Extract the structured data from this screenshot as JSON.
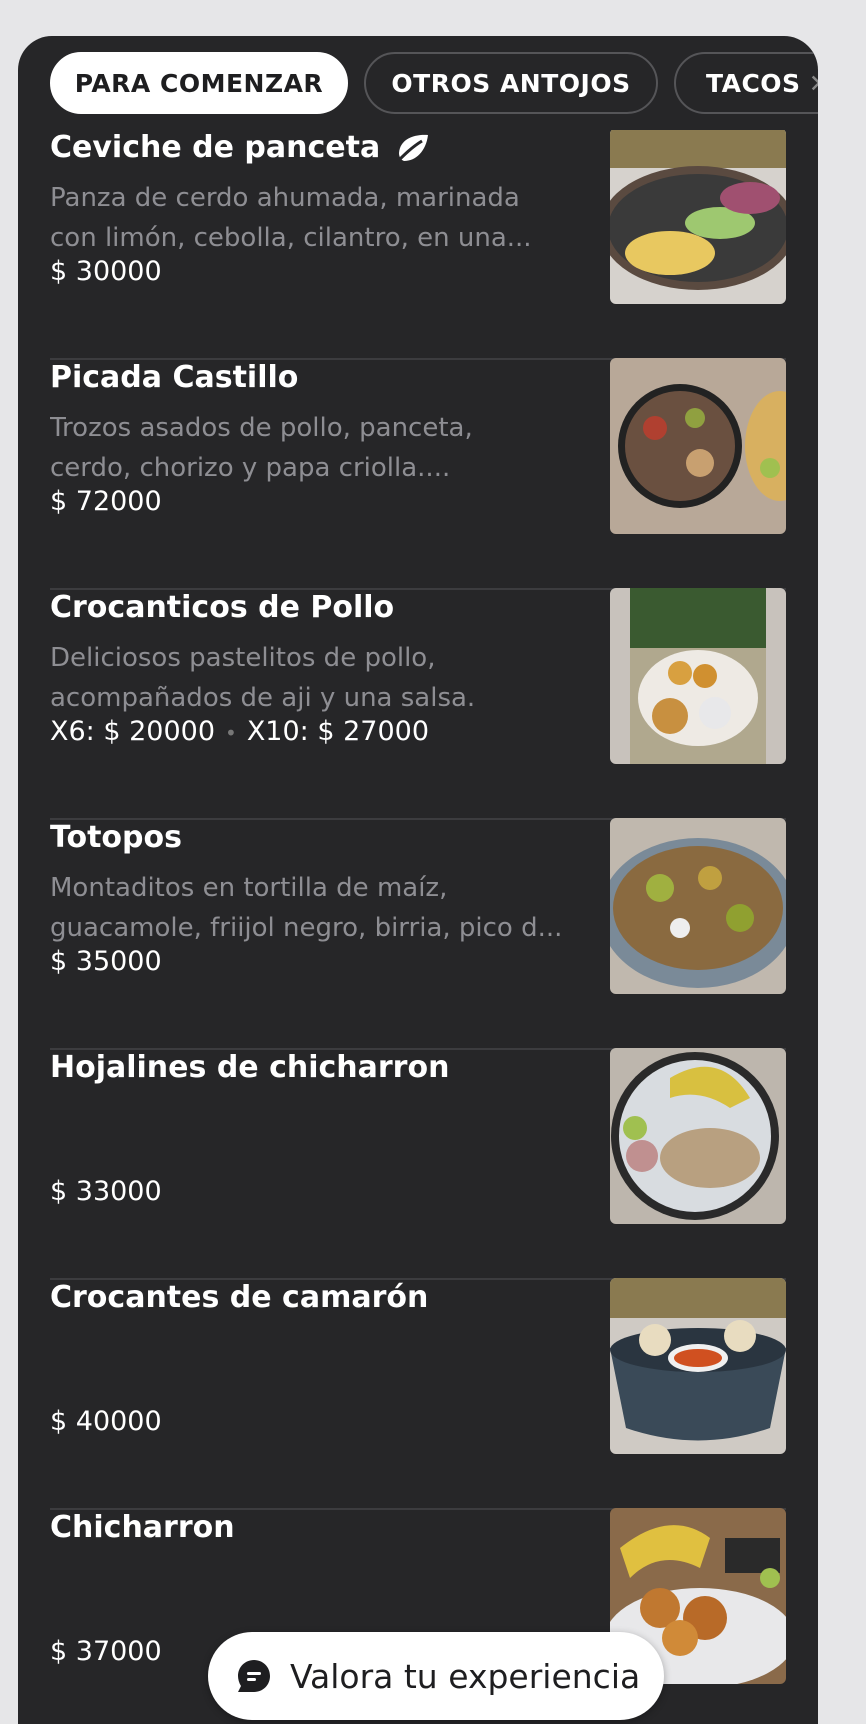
{
  "tabs": [
    {
      "label": "PARA COMENZAR",
      "active": true
    },
    {
      "label": "OTROS ANTOJOS",
      "active": false
    },
    {
      "label": "TACOS",
      "active": false
    }
  ],
  "items": [
    {
      "title": "Ceviche de panceta",
      "icon": "leaf-icon",
      "desc": [
        "Panza de cerdo ahumada, marinada",
        "con limón, cebolla, cilantro, en una..."
      ],
      "price": "$ 30000"
    },
    {
      "title": "Picada Castillo",
      "desc": [
        "Trozos asados de pollo, panceta,",
        "cerdo, chorizo y papa criolla...."
      ],
      "price": "$ 72000"
    },
    {
      "title": "Crocanticos de Pollo",
      "desc": [
        "Deliciosos pastelitos de pollo,",
        "acompañados de aji y una salsa."
      ],
      "price_a": "X6: $ 20000",
      "price_b": "X10: $ 27000"
    },
    {
      "title": "Totopos",
      "desc": [
        "Montaditos en tortilla de maíz,",
        "guacamole, friijol negro, birria, pico d..."
      ],
      "price": "$ 35000"
    },
    {
      "title": "Hojalines de chicharron",
      "price": "$ 33000"
    },
    {
      "title": "Crocantes de camarón",
      "price": "$ 40000"
    },
    {
      "title": "Chicharron",
      "price": "$ 37000"
    }
  ],
  "cta": {
    "label": "Valora tu experiencia",
    "icon": "chat-icon"
  },
  "colors": {
    "background": "#e6e6e8",
    "panel": "#262628",
    "text": "#ffffff",
    "muted": "#8e8e93"
  }
}
